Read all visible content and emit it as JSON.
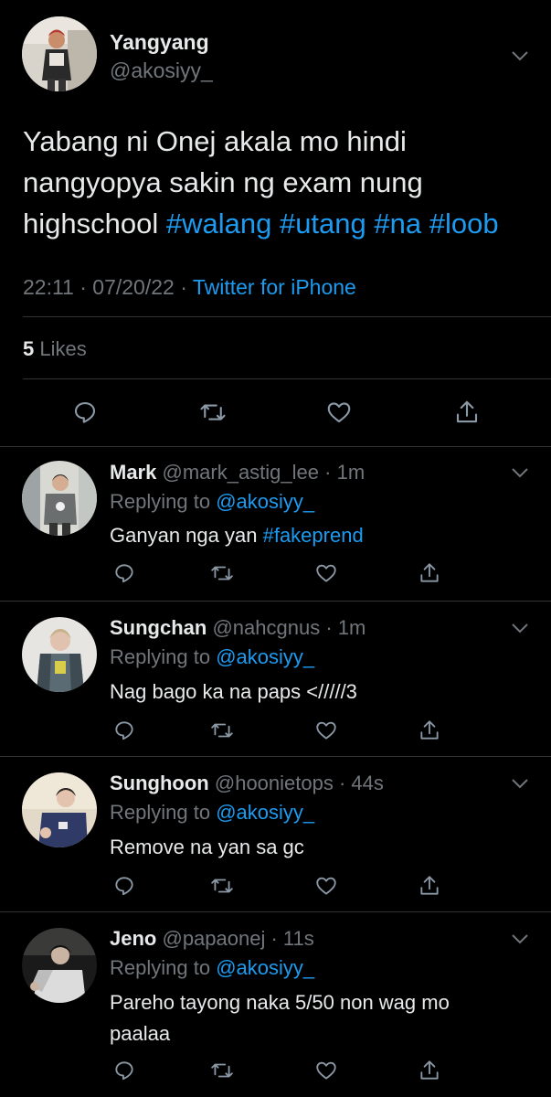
{
  "main_tweet": {
    "name": "Yangyang",
    "handle": "@akosiyy_",
    "text_plain": "Yabang ni Onej akala mo hindi nangyopya sakin ng exam nung highschool",
    "hashtags": [
      "#walang",
      "#utang",
      "#na",
      "#loob"
    ],
    "time": "22:11 · 07/20/22 ·",
    "source": "Twitter for iPhone",
    "likes_count": "5",
    "likes_label": "Likes"
  },
  "replies": [
    {
      "name": "Mark",
      "handle": "@mark_astig_lee",
      "time": "· 1m",
      "replying_label": "Replying to",
      "replying_to": "@akosiyy_",
      "text": "Ganyan nga yan",
      "hashtag": "#fakeprend"
    },
    {
      "name": "Sungchan",
      "handle": "@nahcgnus",
      "time": "· 1m",
      "replying_label": "Replying to",
      "replying_to": "@akosiyy_",
      "text": "Nag bago ka na paps </////3",
      "hashtag": ""
    },
    {
      "name": "Sunghoon",
      "handle": "@hoonietops",
      "time": "· 44s",
      "replying_label": "Replying to",
      "replying_to": "@akosiyy_",
      "text": "Remove na yan sa gc",
      "hashtag": ""
    },
    {
      "name": "Jeno",
      "handle": "@papaonej",
      "time": "· 11s",
      "replying_label": "Replying to",
      "replying_to": "@akosiyy_",
      "text": "Pareho tayong naka 5/50 non wag mo paalaa",
      "hashtag": ""
    }
  ],
  "icons": {
    "reply": "reply-icon",
    "retweet": "retweet-icon",
    "like": "heart-icon",
    "share": "share-icon",
    "more": "chevron-down-icon"
  },
  "colors": {
    "background": "#000000",
    "text": "#e7e9ea",
    "muted": "#71767b",
    "link": "#1d9bf0",
    "divider": "#2f3336"
  }
}
